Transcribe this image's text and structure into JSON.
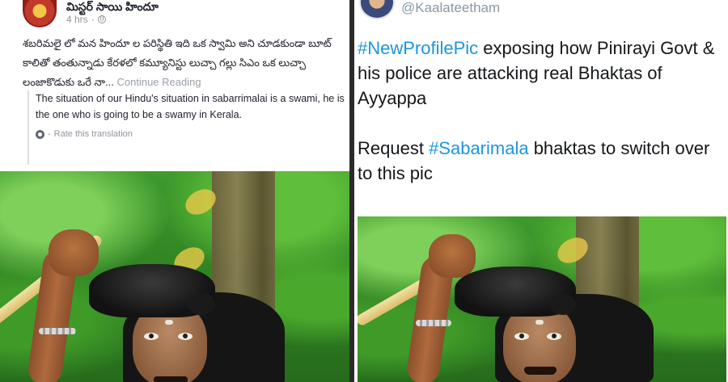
{
  "facebook_post": {
    "author_name": "మిస్టర్ సాయి హిందూ",
    "timestamp": "4 hrs",
    "separator": "·",
    "body_text": "శబరిమలై లో మన హిందూ ల పరిస్థితి ఇది ఒక స్వామి అని చూడకుండా బూట్ కాలితో తంతున్నాడు కేరళలో కమ్యూనిస్టు లుచ్చా గల్లు సిఎం ఒక లుచ్చా లంజాకొడుకు ఒరే నా...",
    "continue_reading": "Continue Reading",
    "translation": "The situation of our Hindu's situation in sabarrimalai is a swami, he is the one who is going to be a swamy in Kerala.",
    "rate_translation": "Rate this translation"
  },
  "tweet": {
    "handle": "@Kaalateetham",
    "paragraph1": {
      "hashtag": "#NewProfilePic",
      "text": " exposing how Pinirayi Govt & his police are attacking real Bhaktas of Ayyappa"
    },
    "paragraph2": {
      "prefix": "Request ",
      "hashtag": "#Sabarimala",
      "text": " bhaktas to switch over to this pic"
    }
  },
  "colors": {
    "hashtag": "#1b95e0",
    "fb_meta": "#90949c",
    "fb_text": "#1d2129",
    "divider": "#2b2b2b"
  },
  "icons": [
    "globe-icon",
    "gear-icon"
  ]
}
